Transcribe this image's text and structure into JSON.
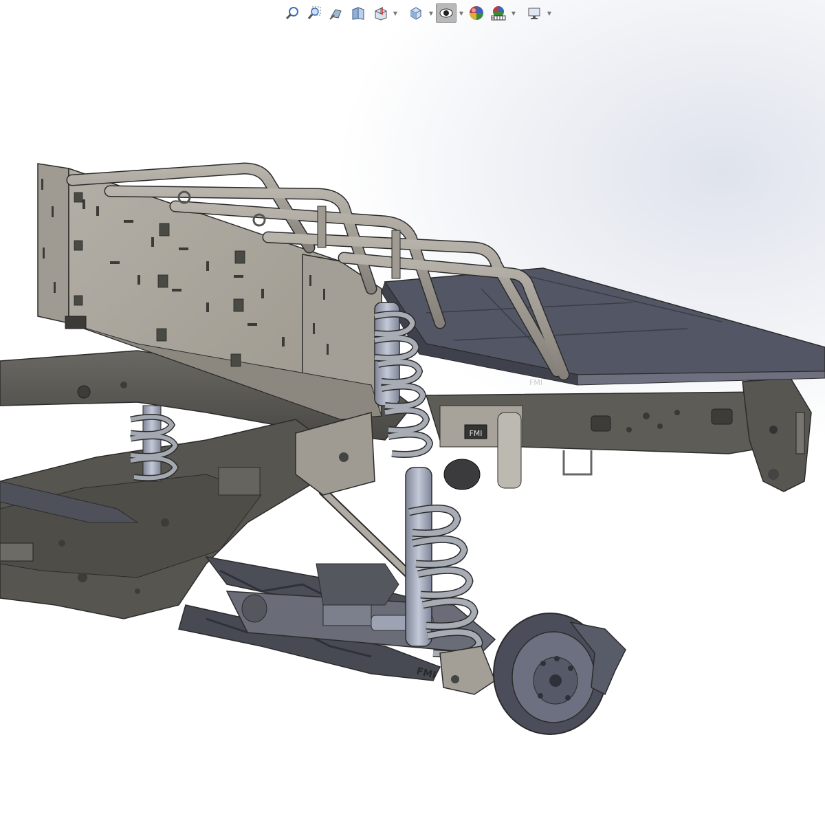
{
  "toolbar": {
    "buttons": [
      {
        "id": "zoom-to-fit",
        "icon": "magnify-icon"
      },
      {
        "id": "zoom-to-area",
        "icon": "zoom-area-icon"
      },
      {
        "id": "previous-view",
        "icon": "previous-view-icon"
      },
      {
        "id": "section-view",
        "icon": "section-view-icon"
      },
      {
        "id": "dynamic-annotation",
        "icon": "annotation-view-icon"
      },
      {
        "id": "view-orientation",
        "icon": "cube-icon"
      },
      {
        "id": "display-style",
        "icon": "shaded-edges-icon"
      },
      {
        "id": "hide-show-items",
        "icon": "eye-icon"
      },
      {
        "id": "edit-appearance",
        "icon": "appearance-sphere-icon"
      },
      {
        "id": "apply-scene",
        "icon": "scene-icon"
      },
      {
        "id": "view-settings",
        "icon": "monitor-icon"
      }
    ]
  },
  "model": {
    "logos": [
      "FMI",
      "FMI",
      "FMI"
    ]
  },
  "colors": {
    "frame": "#55534f",
    "frame_light": "#6b6964",
    "panel": "#a9a59c",
    "panel_dark": "#8f8b83",
    "tube": "#9a968e",
    "bed_plate": "#4e5260",
    "spring": "#9ea3ad",
    "shock_body": "#aab1c6",
    "arm": "#4b4d57",
    "rotor": "#5a5d68",
    "edge": "#2b2b2b"
  }
}
